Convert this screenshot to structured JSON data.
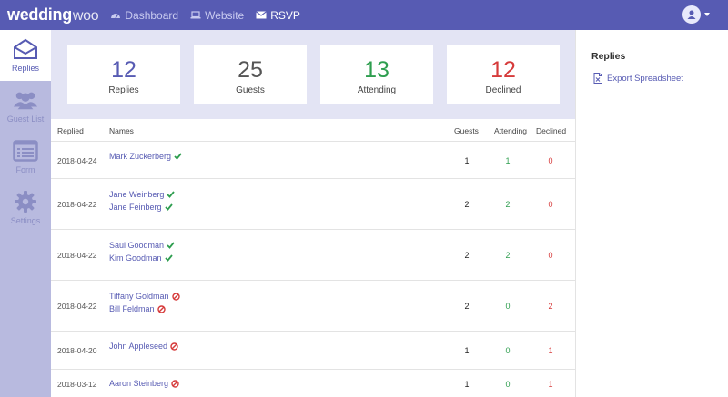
{
  "colors": {
    "brand": "#575bb3",
    "attending": "#2e9e4f",
    "declined": "#d63b3b",
    "sidebar": "#b8badf"
  },
  "topbar": {
    "logo_main": "wedding",
    "logo_accent": "woo",
    "nav": [
      {
        "label": "Dashboard",
        "icon": "dashboard-icon"
      },
      {
        "label": "Website",
        "icon": "laptop-icon"
      },
      {
        "label": "RSVP",
        "icon": "envelope-icon",
        "active": true
      }
    ]
  },
  "sidebar": {
    "items": [
      {
        "label": "Replies",
        "icon": "envelope-open-icon",
        "active": true
      },
      {
        "label": "Guest List",
        "icon": "users-icon"
      },
      {
        "label": "Form",
        "icon": "form-icon"
      },
      {
        "label": "Settings",
        "icon": "gear-icon"
      }
    ]
  },
  "stats": [
    {
      "value": "12",
      "label": "Replies",
      "color": "#575bb3"
    },
    {
      "value": "25",
      "label": "Guests",
      "color": "#555555"
    },
    {
      "value": "13",
      "label": "Attending",
      "color": "#2e9e4f"
    },
    {
      "value": "12",
      "label": "Declined",
      "color": "#d63b3b"
    }
  ],
  "table": {
    "headers": {
      "replied": "Replied",
      "names": "Names",
      "guests": "Guests",
      "attending": "Attending",
      "declined": "Declined"
    },
    "rows": [
      {
        "date": "2018-04-24",
        "names": [
          {
            "name": "Mark Zuckerberg",
            "status": "attending"
          }
        ],
        "guests": "1",
        "attending": "1",
        "declined": "0"
      },
      {
        "date": "2018-04-22",
        "names": [
          {
            "name": "Jane Weinberg",
            "status": "attending"
          },
          {
            "name": "Jane Feinberg",
            "status": "attending"
          }
        ],
        "guests": "2",
        "attending": "2",
        "declined": "0"
      },
      {
        "date": "2018-04-22",
        "names": [
          {
            "name": "Saul Goodman",
            "status": "attending"
          },
          {
            "name": "Kim Goodman",
            "status": "attending"
          }
        ],
        "guests": "2",
        "attending": "2",
        "declined": "0"
      },
      {
        "date": "2018-04-22",
        "names": [
          {
            "name": "Tiffany Goldman",
            "status": "declined"
          },
          {
            "name": "Bill Feldman",
            "status": "declined"
          }
        ],
        "guests": "2",
        "attending": "0",
        "declined": "2"
      },
      {
        "date": "2018-04-20",
        "names": [
          {
            "name": "John Appleseed",
            "status": "declined"
          }
        ],
        "guests": "1",
        "attending": "0",
        "declined": "1"
      },
      {
        "date": "2018-03-12",
        "names": [
          {
            "name": "Aaron Steinberg",
            "status": "declined"
          }
        ],
        "guests": "1",
        "attending": "0",
        "declined": "1"
      }
    ]
  },
  "panel": {
    "title": "Replies",
    "export_label": "Export Spreadsheet",
    "export_icon": "spreadsheet-icon"
  }
}
